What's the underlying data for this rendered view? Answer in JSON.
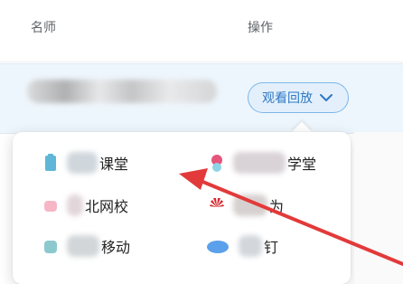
{
  "table": {
    "col_teacher": "名师",
    "col_action": "操作"
  },
  "row": {
    "replay_label": "观看回放"
  },
  "menu": {
    "items": [
      {
        "label": "课堂",
        "icon": "teal-phone-icon"
      },
      {
        "label": "学堂",
        "icon": "red-pink-icon"
      },
      {
        "label": "北网校",
        "icon": "pink-icon"
      },
      {
        "label": "为",
        "icon": "huawei-icon"
      },
      {
        "label": "移动",
        "icon": "teal-icon"
      },
      {
        "label": "钉",
        "icon": "blue-cloud-icon"
      }
    ]
  },
  "colors": {
    "accent": "#2f78c4",
    "arrow": "#e23a3a",
    "row_highlight": "#eef6fd"
  }
}
